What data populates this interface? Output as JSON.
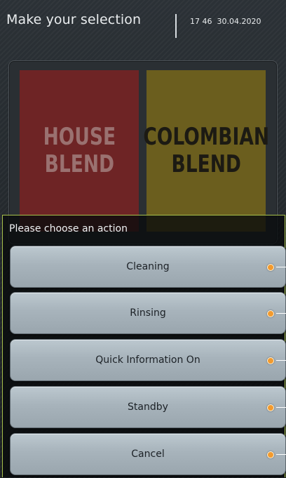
{
  "header": {
    "title": "Make your selection",
    "time": "17 46",
    "date": "30.04.2020"
  },
  "tiles": [
    {
      "label": "HOUSE\nBLEND",
      "color": "#6e2425"
    },
    {
      "label": "COLOMBIAN\nBLEND",
      "color": "#6b5e1e"
    }
  ],
  "dialog": {
    "prompt": "Please choose an action",
    "actions": [
      {
        "label": "Cleaning",
        "indicator": "orange-dot"
      },
      {
        "label": "Rinsing",
        "indicator": "orange-dot"
      },
      {
        "label": "Quick Information On",
        "indicator": "orange-dot"
      },
      {
        "label": "Standby",
        "indicator": "orange-dot"
      },
      {
        "label": "Cancel",
        "indicator": "orange-dot"
      }
    ],
    "border_color": "#a7c04b",
    "indicator_color": "#f29a2e"
  }
}
